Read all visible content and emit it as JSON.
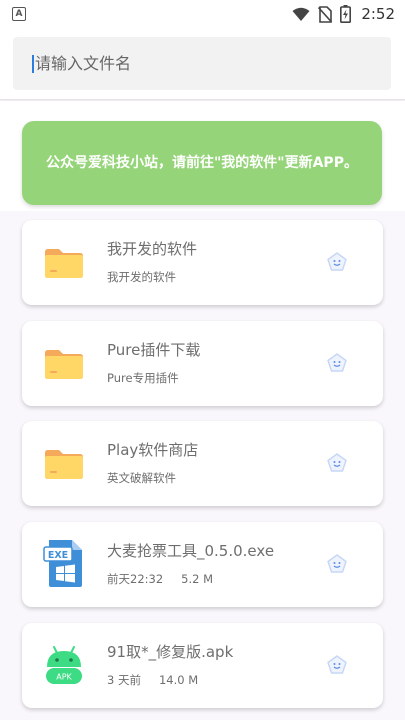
{
  "status_bar": {
    "notification_icon": "a-notification-icon",
    "time": "2:52"
  },
  "search": {
    "placeholder": "请输入文件名",
    "value": ""
  },
  "banner": {
    "text": "公众号爱科技小站，请前往\"我的软件\"更新APP。",
    "color": "#96d47a"
  },
  "files": [
    {
      "icon": "folder-icon",
      "title": "我开发的软件",
      "subtitle": "我开发的软件"
    },
    {
      "icon": "folder-icon",
      "title": "Pure插件下载",
      "subtitle": "Pure专用插件"
    },
    {
      "icon": "folder-icon",
      "title": "Play软件商店",
      "subtitle": "英文破解软件"
    },
    {
      "icon": "exe-file-icon",
      "title": "大麦抢票工具_0.5.0.exe",
      "time": "前天22:32",
      "size": "5.2 M"
    },
    {
      "icon": "apk-file-icon",
      "title": "91取*_修复版.apk",
      "time": "3 天前",
      "size": "14.0 M"
    }
  ],
  "colors": {
    "folder": "#ffd766",
    "exe": "#3f8fd8",
    "apk": "#3ddc84",
    "action_icon": "#7aa6f0"
  }
}
